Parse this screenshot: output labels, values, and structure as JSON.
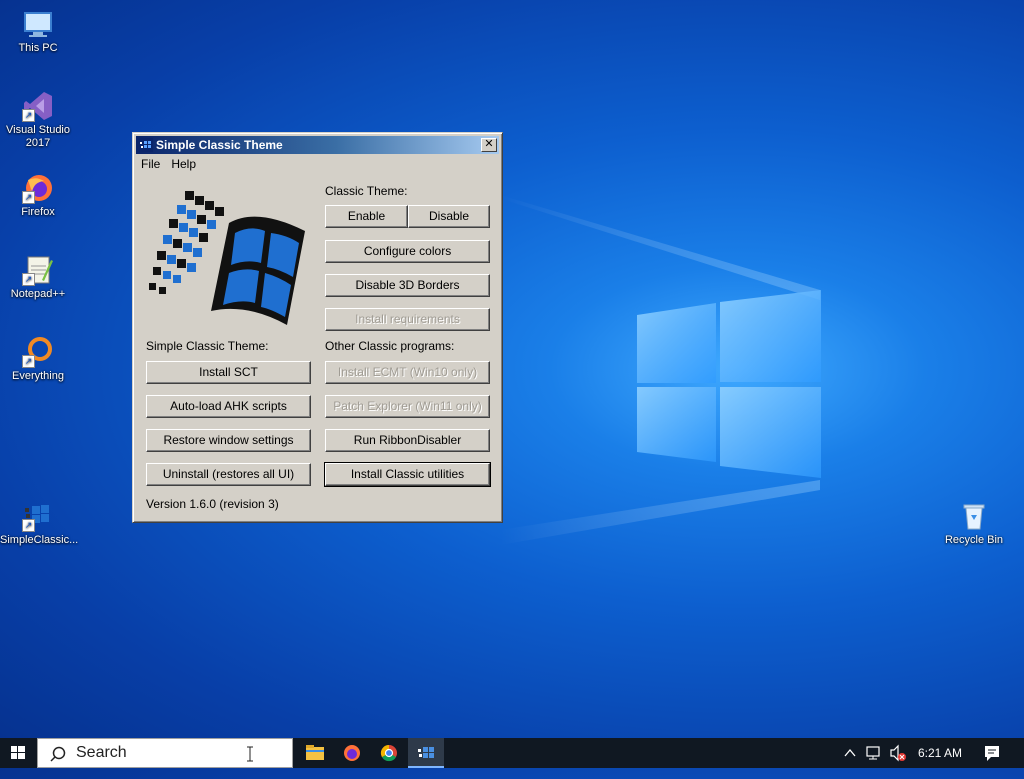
{
  "desktop": {
    "icons": [
      {
        "label": "This PC"
      },
      {
        "label": "Visual Studio 2017"
      },
      {
        "label": "Firefox"
      },
      {
        "label": "Notepad++"
      },
      {
        "label": "Everything"
      },
      {
        "label": "SimpleClassic..."
      },
      {
        "label": "Recycle Bin"
      }
    ]
  },
  "window": {
    "title": "Simple Classic Theme",
    "close_glyph": "✕",
    "menu": [
      "File",
      "Help"
    ],
    "classic_theme_label": "Classic Theme:",
    "enable_label": "Enable",
    "disable_label": "Disable",
    "configure_colors_label": "Configure colors",
    "disable_3d_borders_label": "Disable 3D Borders",
    "install_requirements_label": "Install requirements",
    "sct_section_label": "Simple Classic Theme:",
    "other_section_label": "Other Classic programs:",
    "install_sct_label": "Install SCT",
    "autoload_ahk_label": "Auto-load AHK scripts",
    "restore_window_label": "Restore window settings",
    "uninstall_label": "Uninstall (restores all UI)",
    "install_ecmt_label": "Install ECMT (Win10 only)",
    "patch_explorer_label": "Patch Explorer (Win11 only)",
    "run_ribbon_label": "Run RibbonDisabler",
    "install_utilities_label": "Install Classic utilities",
    "version_text": "Version 1.6.0 (revision 3)"
  },
  "taskbar": {
    "search_placeholder": "Search",
    "time": "6:21 AM",
    "apps": [
      "file-explorer",
      "firefox",
      "chrome",
      "simple-classic-theme"
    ]
  },
  "colors": {
    "classic_face": "#d4d0c8",
    "title_gradient_start": "#0a246a",
    "title_gradient_end": "#a6caf0",
    "desktop_blue": "#0d5fcf"
  }
}
